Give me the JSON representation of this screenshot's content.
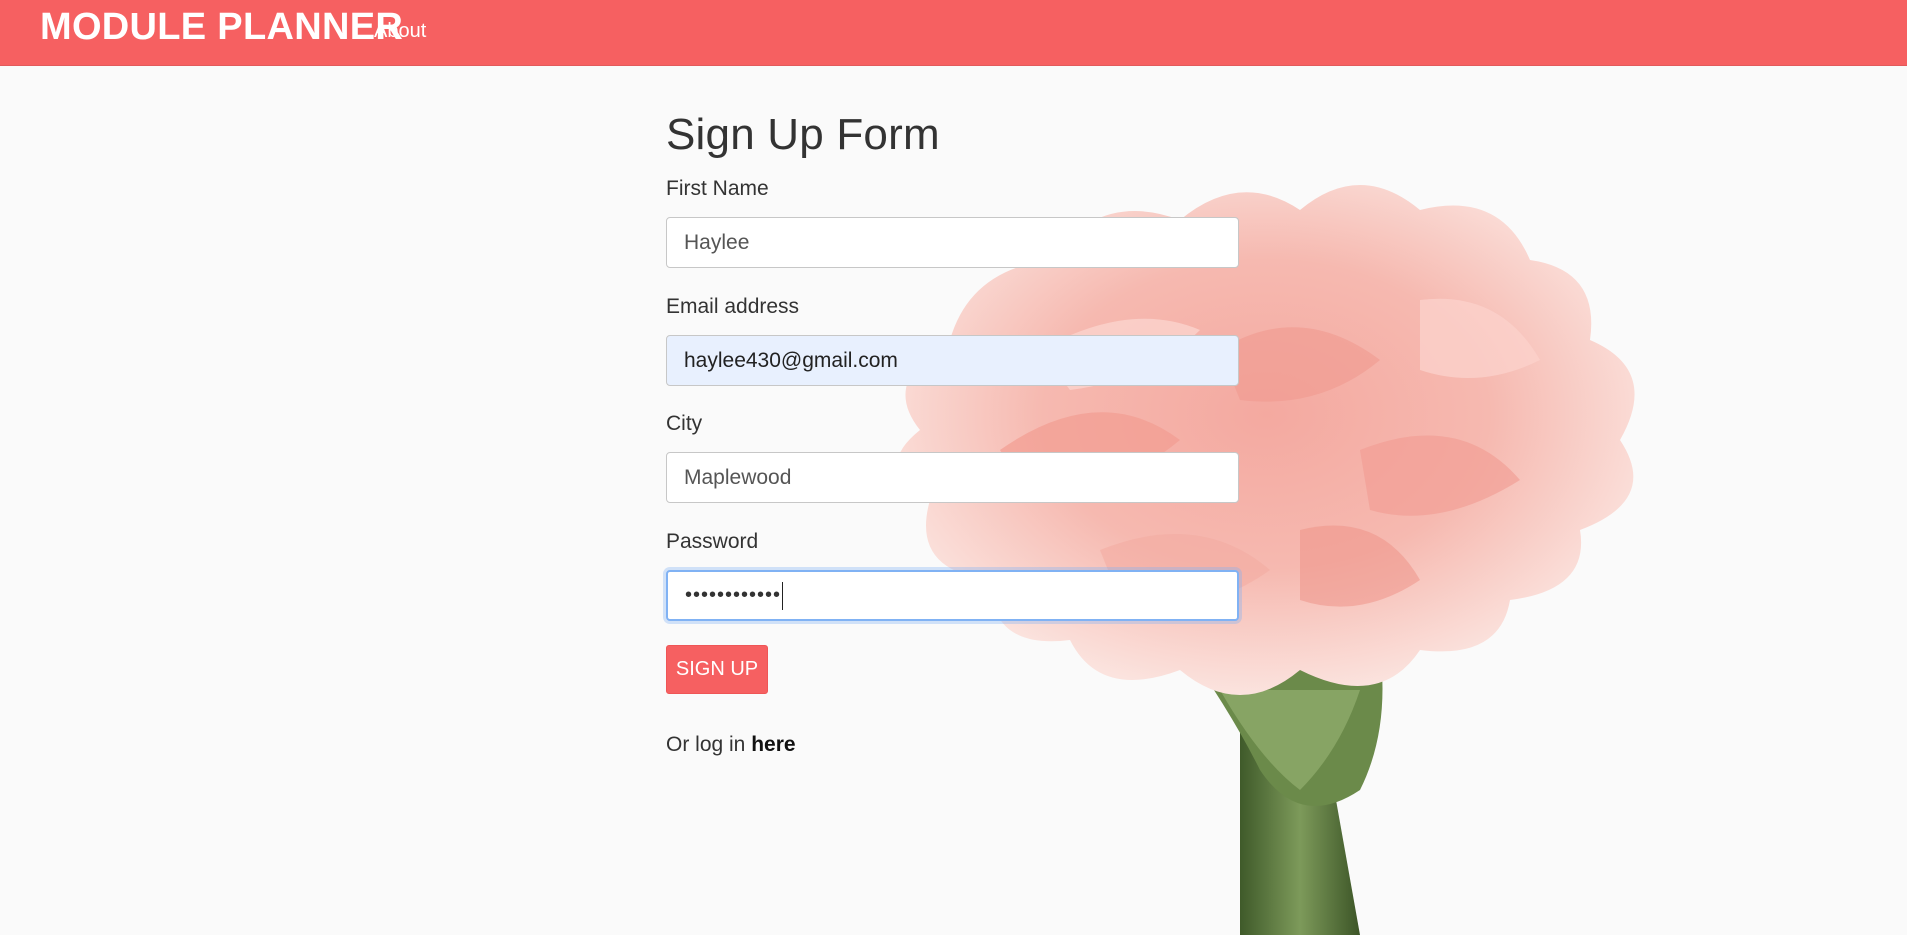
{
  "navbar": {
    "brand": "MODULE PLANNER",
    "about_label": "About"
  },
  "form": {
    "title": "Sign Up Form",
    "first_name": {
      "label": "First Name",
      "value": "Haylee"
    },
    "email": {
      "label": "Email address",
      "value": "haylee430@gmail.com"
    },
    "city": {
      "label": "City",
      "value": "Maplewood"
    },
    "password": {
      "label": "Password",
      "masked_value": "••••••••••••"
    },
    "submit_label": "SIGN UP",
    "login_prefix": "Or log in ",
    "login_link": "here"
  },
  "colors": {
    "accent": "#f66061",
    "autofill_bg": "#e8f0fe",
    "focus_ring": "#80b2f4"
  },
  "icons": {
    "background_image": "carnation-flower"
  }
}
